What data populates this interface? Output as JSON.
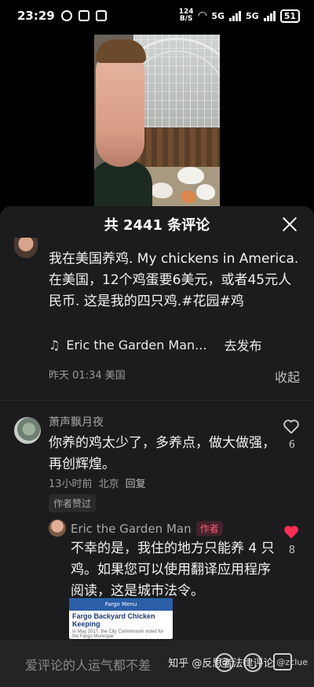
{
  "status_bar": {
    "time": "23:29",
    "net_speed_top": "124",
    "net_speed_bottom": "B/S",
    "signal_1": "5G",
    "signal_2": "5G",
    "battery": "51"
  },
  "sheet": {
    "title": "共 2441 条评论"
  },
  "post": {
    "text": "我在美国养鸡. My chickens in America.\n在美国，12个鸡蛋要6美元，或者45元人民币. 这是我的四只鸡.#花园#鸡",
    "music_title": "Eric the Garden Man...",
    "publish_label": "去发布",
    "time": "昨天 01:34 美国",
    "collapse_label": "收起"
  },
  "comment": {
    "author": "萧声飘月夜",
    "text": "你养的鸡太少了，多养点，做大做强，再创辉煌。",
    "time": "13小时前",
    "location": "北京",
    "reply_label": "回复",
    "author_liked_label": "作者赞过",
    "likes": "6"
  },
  "reply": {
    "author": "Eric the Garden Man",
    "author_badge": "作者",
    "text": "不幸的是，我住的地方只能养 4 只鸡。如果您可以使用翻译应用程序阅读，这是城市法令。",
    "likes": "8",
    "embed": {
      "header": "Fargo Menu",
      "title": "Fargo Backyard Chicken Keeping",
      "body": "In May 2017, the City Commission voted for the Fargo Municipal"
    }
  },
  "input": {
    "placeholder": "爱评论的人运气都不差"
  },
  "watermark": {
    "text": "知乎 @反思者法律评论",
    "secondary": "@zclue"
  },
  "colors": {
    "sheet_bg": "#1c1c1e",
    "like_red": "#ff2d55",
    "author_badge": "#ff5a7a"
  }
}
